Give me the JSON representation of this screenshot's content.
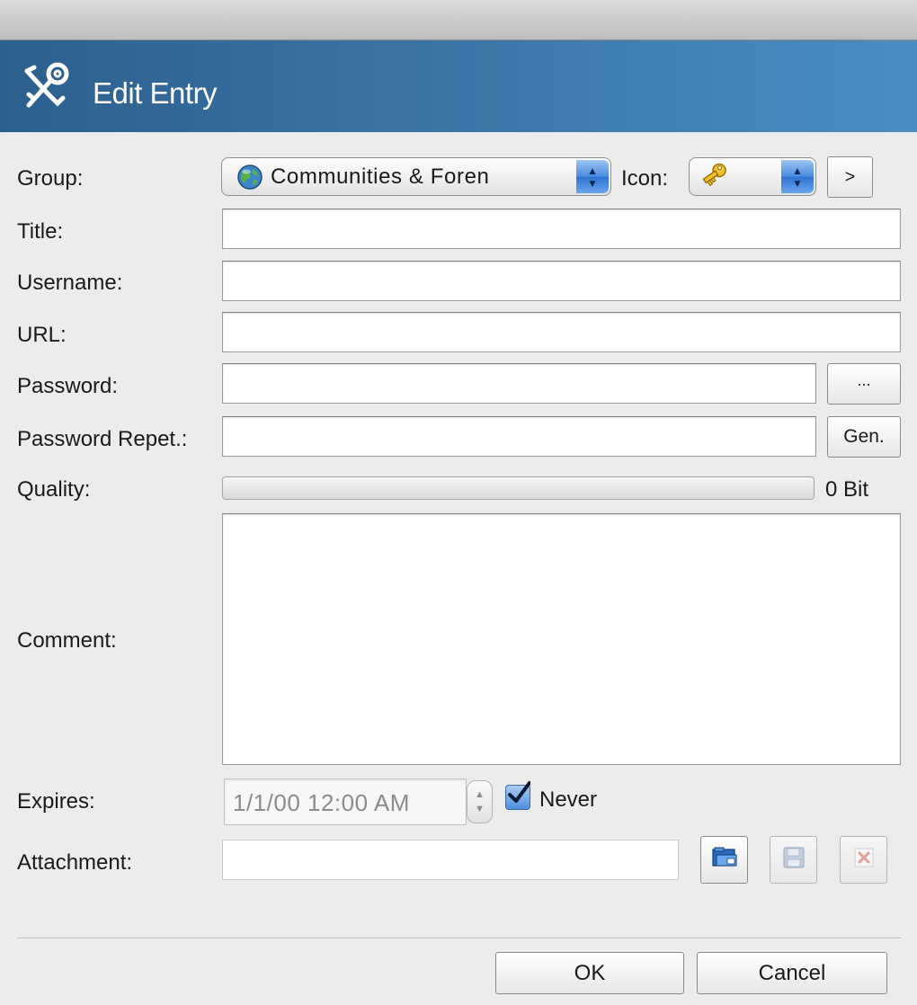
{
  "dialog": {
    "title": "Edit Entry"
  },
  "form": {
    "group_label": "Group:",
    "group_value": "Communities & Foren",
    "icon_label": "Icon:",
    "icon_next_label": ">",
    "title_label": "Title:",
    "title_value": "",
    "username_label": "Username:",
    "username_value": "",
    "url_label": "URL:",
    "url_value": "",
    "password_label": "Password:",
    "password_value": "",
    "password_reveal_label": "...",
    "password_repeat_label": "Password Repet.:",
    "password_repeat_value": "",
    "generate_label": "Gen.",
    "quality_label": "Quality:",
    "quality_value": "0 Bit",
    "quality_fraction": 0,
    "comment_label": "Comment:",
    "comment_value": "",
    "expires_label": "Expires:",
    "expires_value": "1/1/00 12:00 AM",
    "never_label": "Never",
    "never_checked": true,
    "attachment_label": "Attachment:",
    "attachment_value": ""
  },
  "footer": {
    "ok_label": "OK",
    "cancel_label": "Cancel"
  },
  "icons": {
    "banner": "keys-icon",
    "group": "globe-icon",
    "entry": "key-icon",
    "attach_open": "folder-open-icon",
    "attach_save": "save-disk-icon",
    "attach_delete": "delete-icon"
  },
  "colors": {
    "banner_start": "#2c5f8e",
    "banner_end": "#4a8dc2",
    "checkbox": "#2f72cf"
  }
}
